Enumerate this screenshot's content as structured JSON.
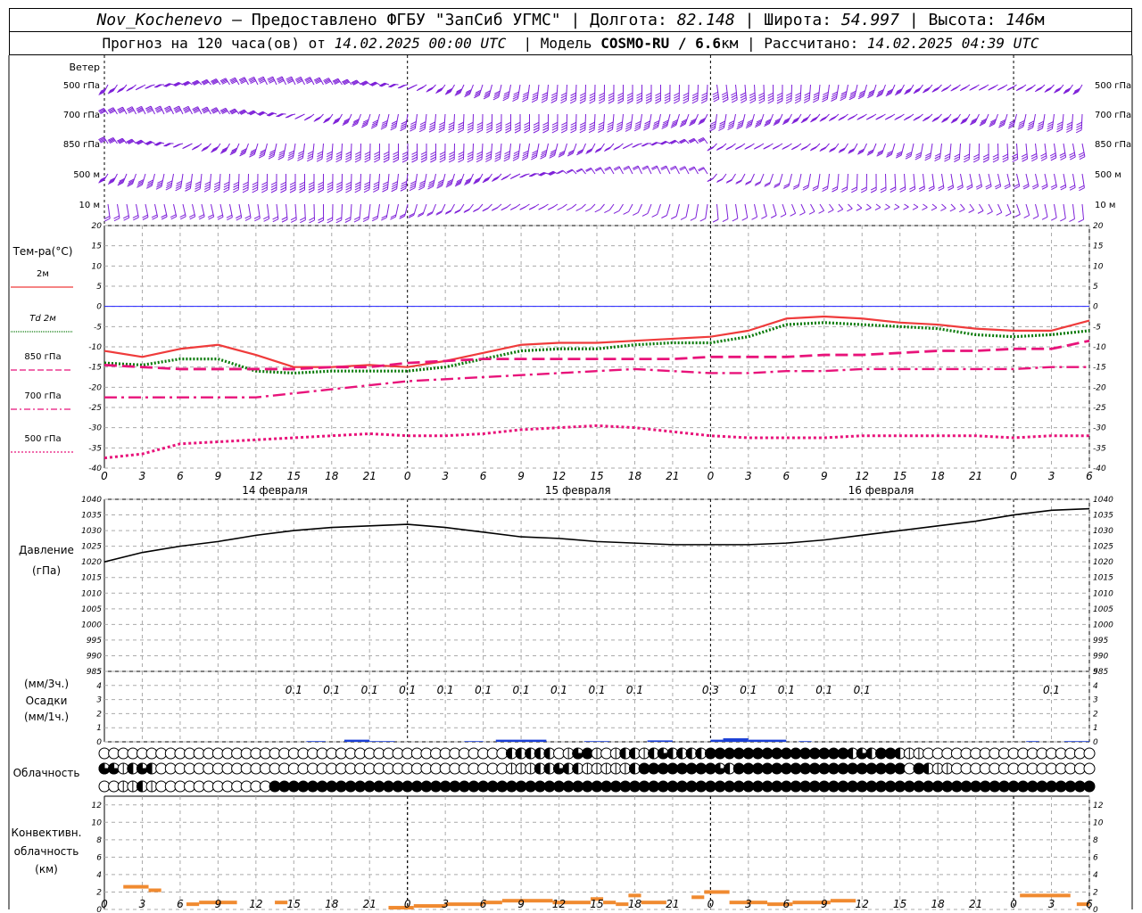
{
  "header": {
    "station": "Nov_Kochenevo",
    "provided_by": "– Предоставлено ФГБУ \"ЗапСиб УГМС\"",
    "lon_label": "Долгота:",
    "lon": "82.148",
    "lat_label": "Широта:",
    "lat": "54.997",
    "alt_label": "Высота:",
    "alt": "146",
    "alt_unit": "м",
    "forecast_label": "Прогноз на 120 часа(ов) от",
    "forecast_start": "14.02.2025 00:00 UTC",
    "model_label": "Модель",
    "model": "COSMO-RU / 6.6",
    "model_unit": "км",
    "computed_label": "Рассчитано:",
    "computed": "14.02.2025 04:39 UTC"
  },
  "colors": {
    "wind": "#7d1fd8",
    "t2m": "#ef3b3b",
    "td2m": "#0a7a0a",
    "t850": "#e8137a",
    "t700": "#e8137a",
    "t500": "#e8137a",
    "zero_line": "#2020ff",
    "pressure": "#000000",
    "precip": "#1a3fd6",
    "convective": "#f08a30"
  },
  "panels": {
    "wind": {
      "title": "Ветер",
      "levels": [
        "500 гПа",
        "700 гПа",
        "850 гПа",
        "500 м",
        "10 м"
      ]
    },
    "temperature": {
      "title": "Тем-ра(°C)",
      "legend": [
        {
          "label": "2м",
          "style": "solid"
        },
        {
          "label": "Td 2м",
          "style": "dotted"
        },
        {
          "label": "850 гПа",
          "style": "dash"
        },
        {
          "label": "700 гПа",
          "style": "dashdot"
        },
        {
          "label": "500 гПа",
          "style": "dot"
        }
      ],
      "ticks": [
        "20",
        "15",
        "10",
        "5",
        "0",
        "-5",
        "-10",
        "-15",
        "-20",
        "-25",
        "-30",
        "-35",
        "-40"
      ]
    },
    "pressure": {
      "title_line1": "Давление",
      "title_line2": "(гПа)",
      "ticks": [
        "1040",
        "1035",
        "1030",
        "1025",
        "1020",
        "1015",
        "1010",
        "1005",
        "1000",
        "995",
        "990",
        "985"
      ]
    },
    "precip": {
      "title_line1": "(мм/3ч.)",
      "title_line2": "Осадки",
      "title_line3": "(мм/1ч.)",
      "ticks": [
        "5",
        "4",
        "3",
        "2",
        "1",
        "0"
      ]
    },
    "cloud": {
      "title": "Облачность"
    },
    "convective": {
      "title_line1": "Конвективн.",
      "title_line2": "облачность",
      "title_line3": "(км)",
      "ticks": [
        "12",
        "10",
        "8",
        "6",
        "4",
        "2",
        "0"
      ]
    }
  },
  "time_axis": {
    "hour_labels": [
      "0",
      "3",
      "6",
      "9",
      "12",
      "15",
      "18",
      "21",
      "0",
      "3",
      "6",
      "9",
      "12",
      "15",
      "18",
      "21",
      "0",
      "3",
      "6",
      "9",
      "12",
      "15",
      "18",
      "21",
      "0",
      "3",
      "6"
    ],
    "days": [
      "14 февраля",
      "15 февраля",
      "16 февраля"
    ]
  },
  "chart_data": {
    "type": "line",
    "x_hours": [
      0,
      3,
      6,
      9,
      12,
      15,
      18,
      21,
      24,
      27,
      30,
      33,
      36,
      39,
      42,
      45,
      48,
      51,
      54,
      57,
      60,
      63,
      66,
      69,
      72,
      75,
      78
    ],
    "temperature": {
      "ylim": [
        -40,
        20
      ],
      "series": [
        {
          "name": "2м",
          "values": [
            -11,
            -12.5,
            -10.5,
            -9.5,
            -12,
            -15,
            -15,
            -14.5,
            -15,
            -13.5,
            -11.5,
            -9.5,
            -9,
            -9,
            -8.5,
            -8,
            -7.5,
            -6,
            -3,
            -2.5,
            -3,
            -4,
            -4.5,
            -5.5,
            -6,
            -6,
            -3.5
          ]
        },
        {
          "name": "Td 2м",
          "values": [
            -14,
            -14.5,
            -13,
            -13,
            -16,
            -16.5,
            -16,
            -16,
            -16,
            -15,
            -13,
            -11,
            -10.5,
            -10.5,
            -9.5,
            -9,
            -9,
            -7.5,
            -4.5,
            -4,
            -4.5,
            -5,
            -5.5,
            -7,
            -7.5,
            -7,
            -6
          ]
        },
        {
          "name": "850 гПа",
          "values": [
            -14.5,
            -15,
            -15.5,
            -15.5,
            -15.5,
            -15.5,
            -15,
            -15,
            -14,
            -13.5,
            -13,
            -13,
            -13,
            -13,
            -13,
            -13,
            -12.5,
            -12.5,
            -12.5,
            -12,
            -12,
            -11.5,
            -11,
            -11,
            -10.5,
            -10.5,
            -8.5
          ]
        },
        {
          "name": "700 гПа",
          "values": [
            -22.5,
            -22.5,
            -22.5,
            -22.5,
            -22.5,
            -21.5,
            -20.5,
            -19.5,
            -18.5,
            -18,
            -17.5,
            -17,
            -16.5,
            -16,
            -15.5,
            -16,
            -16.5,
            -16.5,
            -16,
            -16,
            -15.5,
            -15.5,
            -15.5,
            -15.5,
            -15.5,
            -15,
            -15
          ]
        },
        {
          "name": "500 гПа",
          "values": [
            -37.5,
            -36.5,
            -34,
            -33.5,
            -33,
            -32.5,
            -32,
            -31.5,
            -32,
            -32,
            -31.5,
            -30.5,
            -30,
            -29.5,
            -30,
            -31,
            -32,
            -32.5,
            -32.5,
            -32.5,
            -32,
            -32,
            -32,
            -32,
            -32.5,
            -32,
            -32
          ]
        }
      ]
    },
    "pressure": {
      "ylim": [
        985,
        1040
      ],
      "values": [
        1020,
        1023,
        1025,
        1026.5,
        1028.5,
        1030,
        1031,
        1031.5,
        1032,
        1031,
        1029.5,
        1028,
        1027.5,
        1026.5,
        1026,
        1025.5,
        1025.5,
        1025.5,
        1026,
        1027,
        1028.5,
        1030,
        1031.5,
        1033,
        1035,
        1036.5,
        1037
      ]
    },
    "precip_labels": [
      {
        "x": 15,
        "text": "0.1"
      },
      {
        "x": 18,
        "text": "0.1"
      },
      {
        "x": 21,
        "text": "0.1"
      },
      {
        "x": 24,
        "text": "0.1"
      },
      {
        "x": 27,
        "text": "0.1"
      },
      {
        "x": 30,
        "text": "0.1"
      },
      {
        "x": 33,
        "text": "0.1"
      },
      {
        "x": 36,
        "text": "0.1"
      },
      {
        "x": 39,
        "text": "0.1"
      },
      {
        "x": 42,
        "text": "0.1"
      },
      {
        "x": 48,
        "text": "0.3"
      },
      {
        "x": 51,
        "text": "0.1"
      },
      {
        "x": 54,
        "text": "0.1"
      },
      {
        "x": 57,
        "text": "0.1"
      },
      {
        "x": 60,
        "text": "0.1"
      },
      {
        "x": 75,
        "text": "0.1"
      }
    ],
    "precip_bars": [
      {
        "x0": 16,
        "x1": 17.5,
        "v": 0.05
      },
      {
        "x0": 19,
        "x1": 21,
        "v": 0.15
      },
      {
        "x0": 21,
        "x1": 23,
        "v": 0.05
      },
      {
        "x0": 28.5,
        "x1": 30,
        "v": 0.05
      },
      {
        "x0": 31,
        "x1": 35,
        "v": 0.15
      },
      {
        "x0": 38,
        "x1": 40,
        "v": 0.05
      },
      {
        "x0": 43,
        "x1": 45,
        "v": 0.1
      },
      {
        "x0": 48,
        "x1": 49,
        "v": 0.15
      },
      {
        "x0": 49,
        "x1": 51,
        "v": 0.25
      },
      {
        "x0": 51,
        "x1": 54,
        "v": 0.15
      },
      {
        "x0": 55,
        "x1": 56,
        "v": 0.05
      },
      {
        "x0": 73,
        "x1": 74,
        "v": 0.05
      },
      {
        "x0": 76,
        "x1": 78,
        "v": 0.05
      }
    ],
    "cloud_rows": {
      "high": [
        0,
        0,
        0,
        0,
        0,
        0,
        0,
        0,
        0,
        0,
        0,
        0,
        0,
        0,
        0,
        0,
        0,
        0,
        0,
        0,
        0,
        0,
        0,
        0,
        0,
        0,
        0,
        0,
        0,
        0,
        0,
        0,
        0,
        0,
        0,
        0,
        0,
        0,
        0,
        0,
        0,
        0,
        0,
        2,
        2,
        2,
        2,
        2,
        0,
        1,
        3,
        4,
        1,
        0,
        1,
        2,
        2,
        1,
        2,
        3,
        2,
        2,
        2,
        2,
        4,
        4,
        4,
        4,
        4,
        4,
        4,
        4,
        4,
        4,
        4,
        4,
        4,
        4,
        4,
        2,
        3,
        2,
        4,
        4,
        2,
        1,
        1,
        0,
        0,
        0,
        0,
        0,
        0,
        0,
        0,
        0,
        0,
        0,
        0,
        0,
        0,
        0,
        0,
        0,
        0
      ],
      "middle": [
        3,
        3,
        1,
        2,
        3,
        2,
        0,
        0,
        0,
        0,
        0,
        0,
        0,
        0,
        0,
        0,
        0,
        0,
        0,
        0,
        0,
        0,
        0,
        0,
        0,
        0,
        0,
        0,
        0,
        0,
        0,
        0,
        0,
        0,
        0,
        0,
        0,
        0,
        0,
        0,
        0,
        0,
        0,
        1,
        1,
        1,
        2,
        2,
        3,
        2,
        2,
        1,
        1,
        1,
        1,
        1,
        2,
        4,
        4,
        4,
        4,
        4,
        4,
        4,
        4,
        3,
        2,
        4,
        4,
        4,
        4,
        4,
        4,
        4,
        4,
        4,
        4,
        4,
        4,
        4,
        4,
        4,
        4,
        4,
        4,
        0,
        4,
        2,
        1,
        1,
        0,
        0,
        0,
        0,
        0,
        0,
        0,
        0,
        0,
        0,
        0,
        0,
        0,
        0,
        0
      ],
      "low": [
        0,
        0,
        1,
        1,
        2,
        1,
        0,
        0,
        0,
        0,
        0,
        0,
        0,
        0,
        0,
        0,
        0,
        0,
        4,
        4,
        4,
        4,
        4,
        4,
        4,
        4,
        4,
        4,
        4,
        4,
        4,
        4,
        4,
        4,
        4,
        4,
        4,
        4,
        4,
        4,
        4,
        4,
        4,
        4,
        4,
        4,
        4,
        4,
        4,
        4,
        4,
        4,
        4,
        4,
        4,
        4,
        4,
        4,
        4,
        4,
        4,
        4,
        4,
        4,
        4,
        4,
        4,
        4,
        4,
        4,
        4,
        4,
        4,
        4,
        4,
        4,
        4,
        4,
        4,
        4,
        4,
        4,
        4,
        4,
        4,
        4,
        4,
        4,
        4,
        4,
        4,
        4,
        4,
        4,
        4,
        4,
        4,
        4,
        4,
        4,
        4,
        4,
        4,
        4,
        4
      ]
    },
    "convective": {
      "ylim": [
        0,
        13
      ],
      "segments": [
        {
          "x0": 1.5,
          "x1": 3.5,
          "v": 2.6
        },
        {
          "x0": 3.5,
          "x1": 4.5,
          "v": 2.2
        },
        {
          "x0": 6.5,
          "x1": 7.5,
          "v": 0.6
        },
        {
          "x0": 7.5,
          "x1": 10.5,
          "v": 0.8
        },
        {
          "x0": 13.5,
          "x1": 14.5,
          "v": 0.8
        },
        {
          "x0": 22.5,
          "x1": 24.5,
          "v": 0.2
        },
        {
          "x0": 24.5,
          "x1": 27,
          "v": 0.4
        },
        {
          "x0": 27,
          "x1": 30,
          "v": 0.6
        },
        {
          "x0": 30,
          "x1": 31.5,
          "v": 0.8
        },
        {
          "x0": 31.5,
          "x1": 35.5,
          "v": 1.0
        },
        {
          "x0": 35.5,
          "x1": 38.5,
          "v": 0.8
        },
        {
          "x0": 38.5,
          "x1": 39.5,
          "v": 1.2
        },
        {
          "x0": 39.5,
          "x1": 40.5,
          "v": 0.8
        },
        {
          "x0": 40.5,
          "x1": 41.5,
          "v": 0.6
        },
        {
          "x0": 41.5,
          "x1": 42.5,
          "v": 1.6
        },
        {
          "x0": 42.5,
          "x1": 44.5,
          "v": 0.8
        },
        {
          "x0": 46.5,
          "x1": 47.5,
          "v": 1.4
        },
        {
          "x0": 47.5,
          "x1": 49.5,
          "v": 2.0
        },
        {
          "x0": 49.5,
          "x1": 52.5,
          "v": 0.8
        },
        {
          "x0": 52.5,
          "x1": 54.5,
          "v": 0.6
        },
        {
          "x0": 54.5,
          "x1": 57.5,
          "v": 0.8
        },
        {
          "x0": 57.5,
          "x1": 59.5,
          "v": 1.0
        },
        {
          "x0": 72.5,
          "x1": 76.5,
          "v": 1.6
        },
        {
          "x0": 77,
          "x1": 78,
          "v": 0.6
        }
      ]
    }
  }
}
